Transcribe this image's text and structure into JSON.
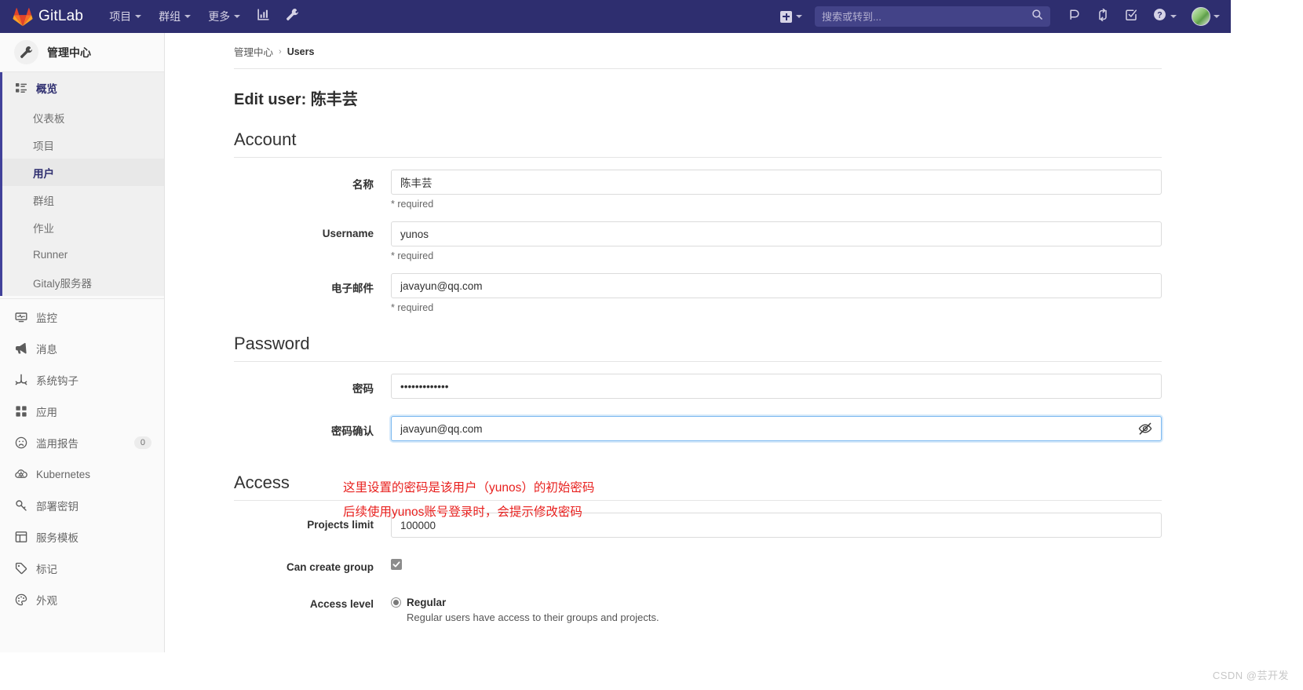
{
  "topnav": {
    "brand": "GitLab",
    "items": [
      {
        "label": "项目",
        "icon": "chevron-down-icon"
      },
      {
        "label": "群组",
        "icon": "chevron-down-icon"
      },
      {
        "label": "更多",
        "icon": "chevron-down-icon"
      }
    ],
    "analytics_icon": "chart-bar-icon",
    "admin_icon": "wrench-icon",
    "create_new_icon": "plus-square-icon",
    "search_placeholder": "搜索或转到...",
    "search_value": "",
    "search_icon": "search-icon",
    "right_icons": [
      {
        "name": "issues-icon"
      },
      {
        "name": "merge-request-icon"
      },
      {
        "name": "todos-icon"
      },
      {
        "name": "help-icon"
      }
    ],
    "avatar": "user-avatar"
  },
  "sidebar": {
    "header": {
      "label": "管理中心",
      "icon": "wrench-icon"
    },
    "overview": {
      "label": "概览",
      "icon": "overview-icon"
    },
    "sub_items": [
      {
        "label": "仪表板",
        "selected": false
      },
      {
        "label": "项目",
        "selected": false
      },
      {
        "label": "用户",
        "selected": true
      },
      {
        "label": "群组",
        "selected": false
      },
      {
        "label": "作业",
        "selected": false
      },
      {
        "label": "Runner",
        "selected": false
      },
      {
        "label": "Gitaly服务器",
        "selected": false
      }
    ],
    "items": [
      {
        "label": "监控",
        "icon": "monitor-icon",
        "badge": ""
      },
      {
        "label": "消息",
        "icon": "megaphone-icon",
        "badge": ""
      },
      {
        "label": "系统钩子",
        "icon": "hook-icon",
        "badge": ""
      },
      {
        "label": "应用",
        "icon": "apps-icon",
        "badge": ""
      },
      {
        "label": "滥用报告",
        "icon": "abuse-icon",
        "badge": "0"
      },
      {
        "label": "Kubernetes",
        "icon": "kubernetes-icon",
        "badge": ""
      },
      {
        "label": "部署密钥",
        "icon": "key-icon",
        "badge": ""
      },
      {
        "label": "服务模板",
        "icon": "template-icon",
        "badge": ""
      },
      {
        "label": "标记",
        "icon": "label-icon",
        "badge": ""
      },
      {
        "label": "外观",
        "icon": "palette-icon",
        "badge": ""
      }
    ]
  },
  "breadcrumb": {
    "root": "管理中心",
    "separator": "›",
    "current": "Users"
  },
  "page_title": "Edit user: 陈丰芸",
  "sections": {
    "account": {
      "title": "Account",
      "fields": [
        {
          "label": "名称",
          "value": "陈丰芸",
          "hint": "* required"
        },
        {
          "label": "Username",
          "value": "yunos",
          "hint": "* required"
        },
        {
          "label": "电子邮件",
          "value": "javayun@qq.com",
          "hint": "* required"
        }
      ]
    },
    "password": {
      "title": "Password",
      "password_label": "密码",
      "password_value": "•••••••••••••",
      "confirm_label": "密码确认",
      "confirm_value": "javayun@qq.com",
      "toggle_icon": "eye-slash-icon"
    },
    "access": {
      "title": "Access",
      "projects_limit_label": "Projects limit",
      "projects_limit_value": "100000",
      "can_create_group_label": "Can create group",
      "can_create_group_checked": true,
      "access_level_label": "Access level",
      "access_level_option": "Regular",
      "access_level_desc": "Regular users have access to their groups and projects."
    }
  },
  "annotation": {
    "line1": "这里设置的密码是该用户（yunos）的初始密码",
    "line2": "后续使用yunos账号登录时，会提示修改密码",
    "color": "#e8201e"
  },
  "watermark": "CSDN @芸开发",
  "colors": {
    "nav_bg": "#2e2e6f",
    "search_bg": "#434388",
    "sidebar_bg": "#fafafa",
    "active_bg": "#e8e8e8",
    "accent": "#2e2e6f",
    "focus_border": "#7ab8f0"
  }
}
